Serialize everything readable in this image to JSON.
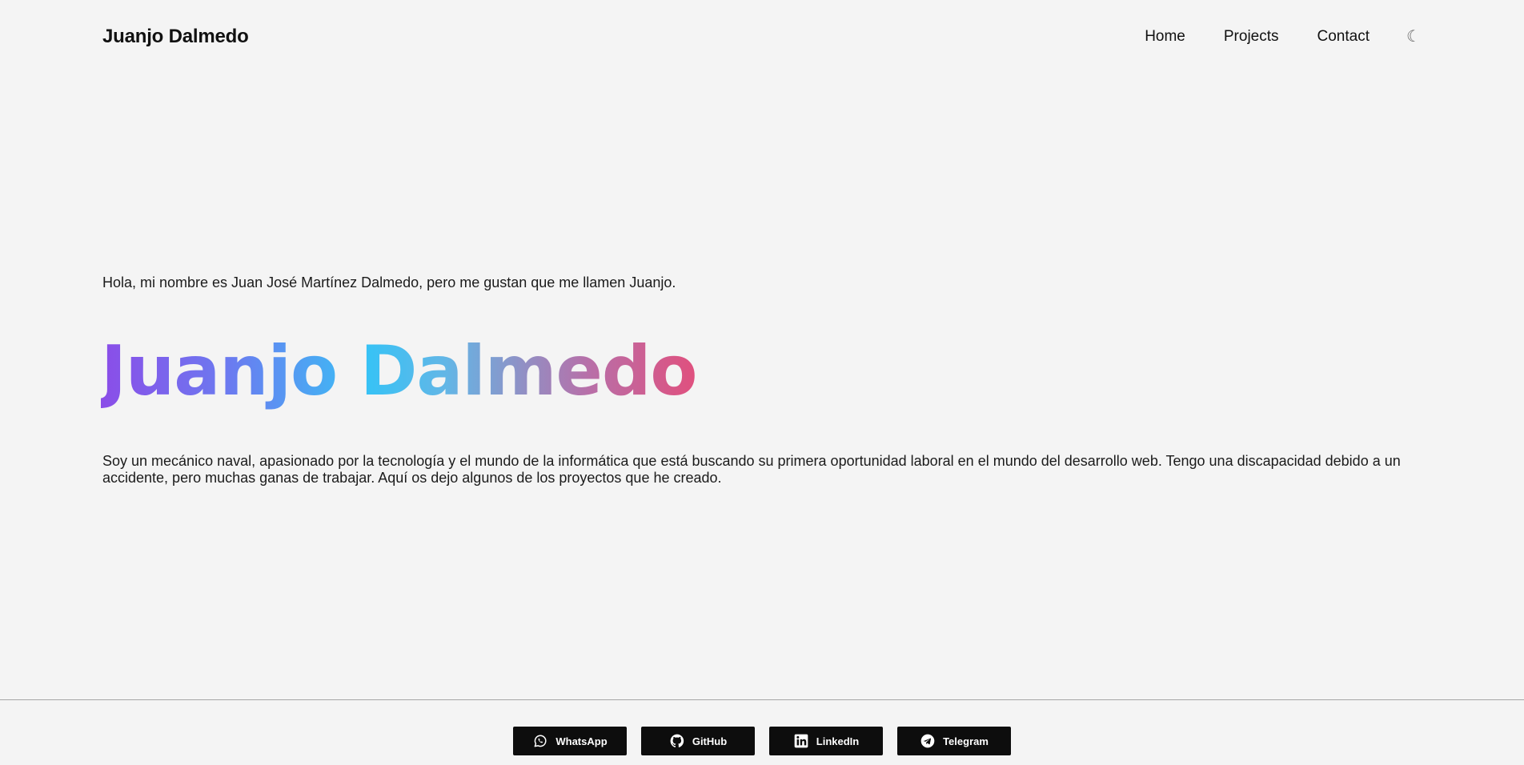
{
  "header": {
    "brand": "Juanjo Dalmedo",
    "nav": [
      {
        "label": "Home"
      },
      {
        "label": "Projects"
      },
      {
        "label": "Contact"
      }
    ],
    "theme_toggle_icon": "moon-icon",
    "theme_toggle_glyph": "☾"
  },
  "hero": {
    "intro": "Hola, mi nombre es Juan José Martínez Dalmedo, pero me gustan que me llamen Juanjo.",
    "title": "Juanjo Dalmedo",
    "title_gradient": [
      "#8b4de8",
      "#38c2f5",
      "#e0507e"
    ],
    "bio": "Soy un mecánico naval, apasionado por la tecnología y el mundo de la informática que está buscando su primera oportunidad laboral en el mundo del desarrollo web. Tengo una discapacidad debido a un accidente, pero muchas ganas de trabajar. Aquí os dejo algunos de los proyectos que he creado."
  },
  "footer": {
    "social": [
      {
        "label": "WhatsApp",
        "icon": "whatsapp-icon"
      },
      {
        "label": "GitHub",
        "icon": "github-icon"
      },
      {
        "label": "LinkedIn",
        "icon": "linkedin-icon"
      },
      {
        "label": "Telegram",
        "icon": "telegram-icon"
      }
    ],
    "button_color": "#0d0d0d"
  },
  "colors": {
    "background": "#f4f4f4",
    "text": "#1b1b1b"
  }
}
